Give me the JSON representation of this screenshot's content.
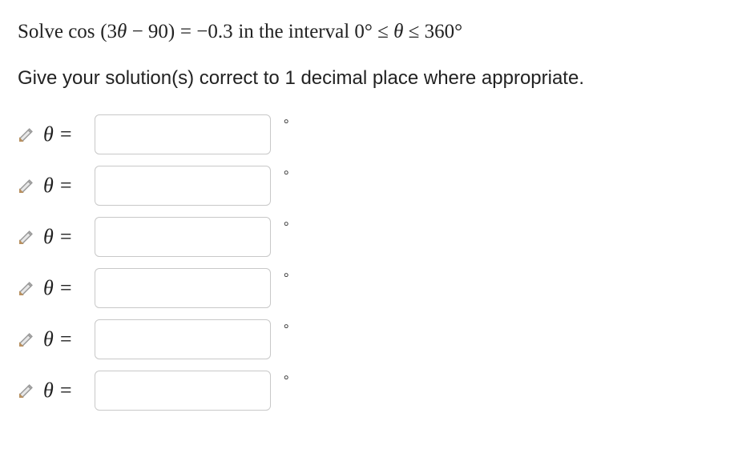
{
  "question": {
    "prefix": "Solve ",
    "equation_lhs_func": "cos",
    "equation_lhs_inner_html": "(3<i>θ</i> − 90)",
    "equals": " = ",
    "equation_rhs": "−0.3",
    "interval_prefix": " in the interval ",
    "interval_html": "0° ≤ <i>θ</i> ≤ 360°"
  },
  "instruction": "Give your solution(s) correct to 1 decimal place where appropriate.",
  "rows": [
    {
      "label_html": "<i>θ</i> =",
      "value": "",
      "unit": "°"
    },
    {
      "label_html": "<i>θ</i> =",
      "value": "",
      "unit": "°"
    },
    {
      "label_html": "<i>θ</i> =",
      "value": "",
      "unit": "°"
    },
    {
      "label_html": "<i>θ</i> =",
      "value": "",
      "unit": "°"
    },
    {
      "label_html": "<i>θ</i> =",
      "value": "",
      "unit": "°"
    },
    {
      "label_html": "<i>θ</i> =",
      "value": "",
      "unit": "°"
    }
  ],
  "icons": {
    "pencil": "pencil-icon"
  }
}
